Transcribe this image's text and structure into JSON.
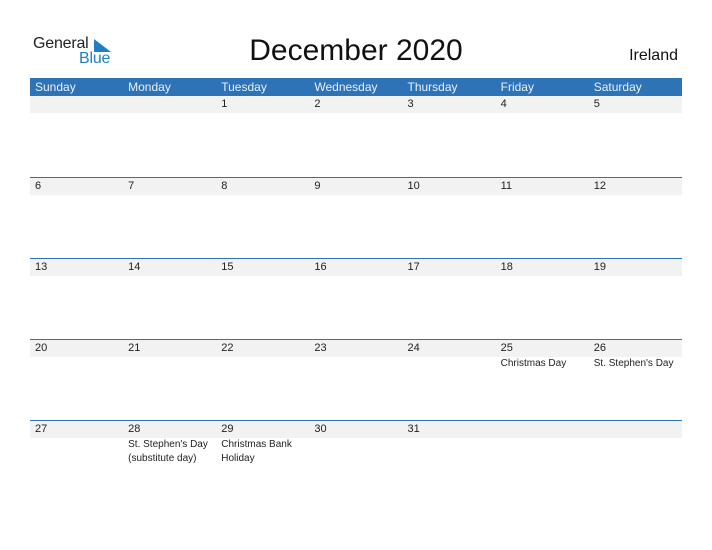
{
  "logo": {
    "line1": "General",
    "line2": "Blue"
  },
  "title": "December 2020",
  "country": "Ireland",
  "colors": {
    "header_bg": "#2e73b5",
    "accent": "#1f7fc4",
    "strip_bg": "#f2f2f2"
  },
  "weekdays": [
    "Sunday",
    "Monday",
    "Tuesday",
    "Wednesday",
    "Thursday",
    "Friday",
    "Saturday"
  ],
  "weeks": [
    {
      "days": [
        "",
        "",
        "1",
        "2",
        "3",
        "4",
        "5"
      ],
      "holidays": [
        "",
        "",
        "",
        "",
        "",
        "",
        ""
      ]
    },
    {
      "days": [
        "6",
        "7",
        "8",
        "9",
        "10",
        "11",
        "12"
      ],
      "holidays": [
        "",
        "",
        "",
        "",
        "",
        "",
        ""
      ]
    },
    {
      "days": [
        "13",
        "14",
        "15",
        "16",
        "17",
        "18",
        "19"
      ],
      "holidays": [
        "",
        "",
        "",
        "",
        "",
        "",
        ""
      ]
    },
    {
      "days": [
        "20",
        "21",
        "22",
        "23",
        "24",
        "25",
        "26"
      ],
      "holidays": [
        "",
        "",
        "",
        "",
        "",
        "Christmas Day",
        "St. Stephen's Day"
      ]
    },
    {
      "days": [
        "27",
        "28",
        "29",
        "30",
        "31",
        "",
        ""
      ],
      "holidays": [
        "",
        "St. Stephen's Day (substitute day)",
        "Christmas Bank Holiday",
        "",
        "",
        "",
        ""
      ]
    }
  ]
}
